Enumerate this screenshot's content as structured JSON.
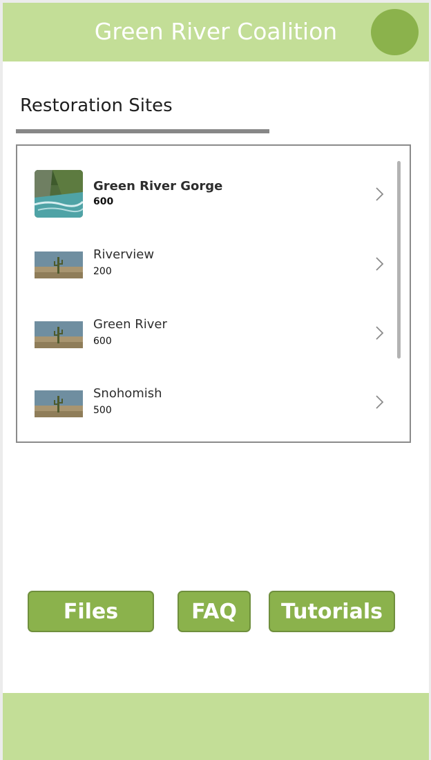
{
  "header": {
    "title": "Green River Coalition",
    "accent": "#c3de97",
    "avatar_color": "#8bb24c"
  },
  "section": {
    "title": "Restoration Sites"
  },
  "sites": [
    {
      "name": "Green River Gorge",
      "value": "600",
      "thumbnail": "river-photo",
      "selected": true
    },
    {
      "name": "Riverview",
      "value": "200",
      "thumbnail": "desert-cactus-photo",
      "selected": false
    },
    {
      "name": "Green River",
      "value": "600",
      "thumbnail": "desert-cactus-photo",
      "selected": false
    },
    {
      "name": "Snohomish",
      "value": "500",
      "thumbnail": "desert-cactus-photo",
      "selected": false
    }
  ],
  "buttons": {
    "files": "Files",
    "faq": "FAQ",
    "tutorials": "Tutorials",
    "color": "#8bb24c"
  },
  "icons": {
    "chevron": "chevron-right-icon"
  }
}
